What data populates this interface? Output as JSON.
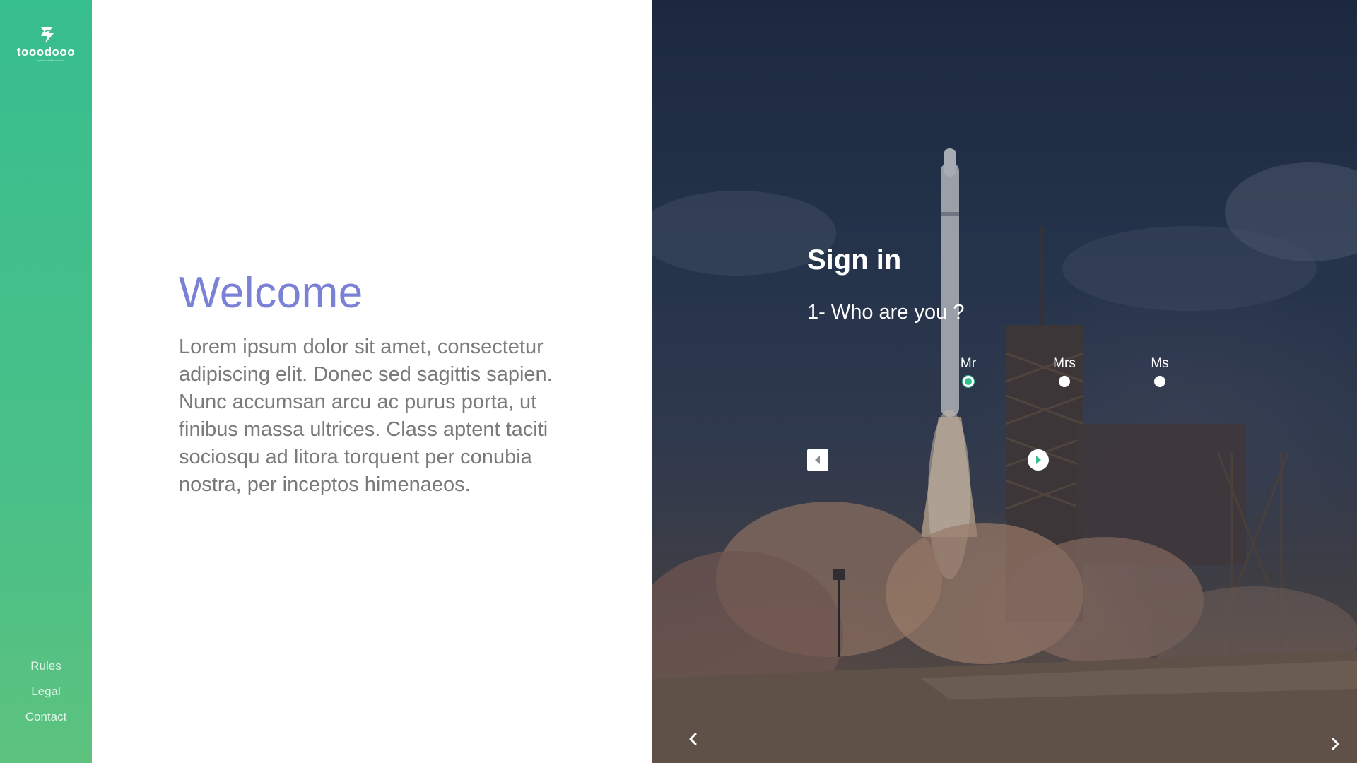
{
  "brand": {
    "name": "tooodooo",
    "tagline": "a product of tooodooo",
    "accent_color": "#37be8f",
    "sidebar_color_top": "#37be8f",
    "sidebar_color_bottom": "#5dc27e"
  },
  "sidebar": {
    "links": [
      {
        "label": "Rules"
      },
      {
        "label": "Legal"
      },
      {
        "label": "Contact"
      }
    ]
  },
  "welcome": {
    "title": "Welcome",
    "title_color": "#7b82d6",
    "body": "Lorem ipsum dolor sit amet, consectetur adipiscing elit. Donec sed sagittis sapien. Nunc accumsan arcu ac purus porta, ut finibus massa ultrices. Class aptent taciti sociosqu ad litora torquent per conubia nostra, per inceptos himenaeos."
  },
  "signin": {
    "title": "Sign in",
    "step_question": "1- Who are you ?",
    "options": [
      {
        "label": "Mr",
        "selected": true
      },
      {
        "label": "Mrs",
        "selected": false
      },
      {
        "label": "Ms",
        "selected": false
      }
    ],
    "prev_icon": "caret-left-icon",
    "next_icon": "caret-right-icon"
  },
  "hero": {
    "image": "rocket-launch-photo",
    "corner_prev_icon": "chevron-left-icon",
    "corner_next_icon": "chevron-right-icon"
  }
}
